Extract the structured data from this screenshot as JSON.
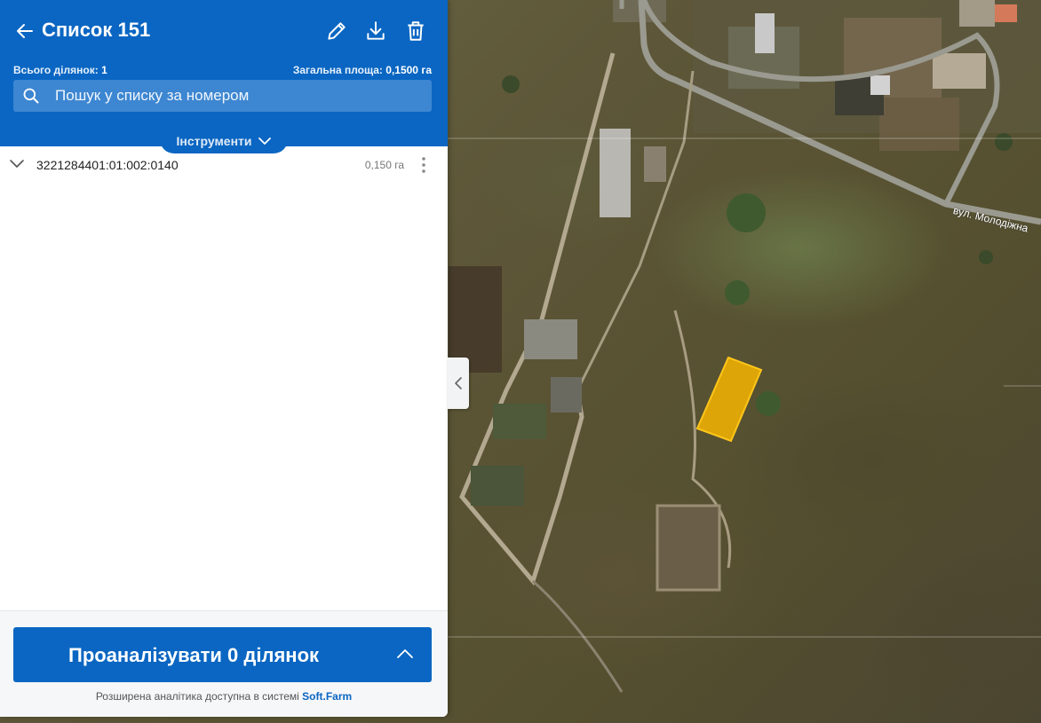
{
  "header": {
    "title": "Список 151",
    "back_icon": "arrow-left-icon",
    "edit_icon": "pencil-icon",
    "download_icon": "download-icon",
    "delete_icon": "trash-icon",
    "total_parcels_label": "Всього ділянок:",
    "total_parcels_value": "1",
    "total_area_label": "Загальна площа:",
    "total_area_value": "0,1500 га"
  },
  "search": {
    "placeholder": "Пошук у списку за номером",
    "icon": "search-icon"
  },
  "tools": {
    "label": "Інструменти",
    "icon": "chevron-down-icon"
  },
  "parcels": [
    {
      "number": "3221284401:01:002:0140",
      "area": "0,150 га"
    }
  ],
  "footer": {
    "analyze_label": "Проаналізувати 0 ділянок",
    "note_text": "Розширена аналітика доступна в системі ",
    "note_link": "Soft.Farm"
  },
  "map": {
    "street_label": "вул. Молодіжна",
    "highlight_color": "#f5b400"
  },
  "colors": {
    "accent": "#0a66c2"
  }
}
